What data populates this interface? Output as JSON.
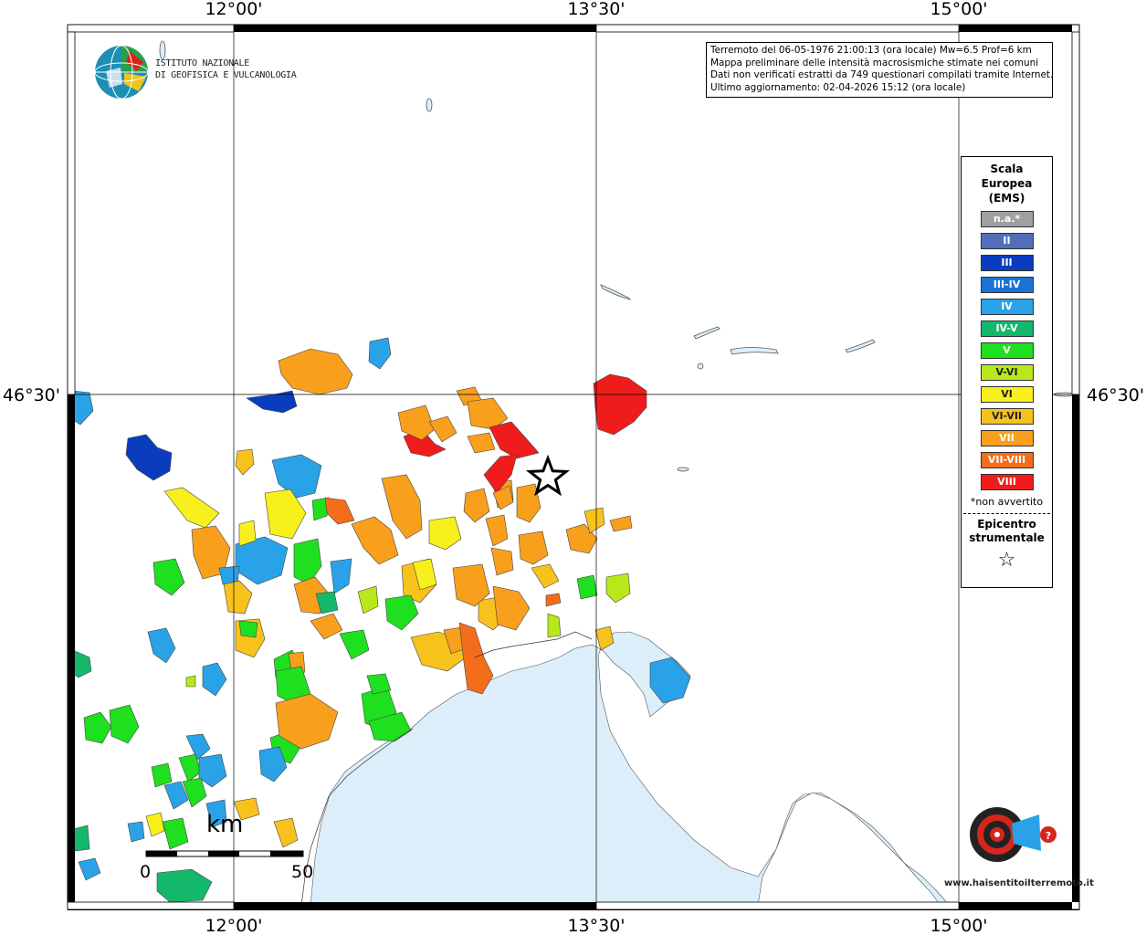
{
  "map": {
    "ticks_top": [
      "12°00'",
      "13°30'",
      "15°00'"
    ],
    "ticks_bottom": [
      "12°00'",
      "13°30'",
      "15°00'"
    ],
    "ticks_left": [
      "46°30'"
    ],
    "ticks_right": [
      "46°30'"
    ]
  },
  "info": {
    "line1": "Terremoto del 06-05-1976 21:00:13 (ora locale) Mw=6.5 Prof=6 km",
    "line2": "Mappa preliminare delle intensità macrosismiche stimate nei comuni",
    "line3": "Dati non verificati estratti da 749 questionari compilati tramite Internet.",
    "line4": "Ultimo aggiornamento: 02-04-2026 15:12 (ora locale)"
  },
  "logo": {
    "line1": "ISTITUTO NAZIONALE",
    "line2": "DI GEOFISICA E VULCANOLOGIA"
  },
  "legend": {
    "title1": "Scala",
    "title2": "Europea",
    "title3": "(EMS)",
    "items": [
      {
        "label": "n.a.*",
        "color": "#a0a0a0"
      },
      {
        "label": "II",
        "color": "#4f6fb8"
      },
      {
        "label": "III",
        "color": "#0a3cbe"
      },
      {
        "label": "III-IV",
        "color": "#1c73d6"
      },
      {
        "label": "IV",
        "color": "#2aa2e8"
      },
      {
        "label": "IV-V",
        "color": "#14b86a"
      },
      {
        "label": "V",
        "color": "#1ee01e"
      },
      {
        "label": "V-VI",
        "color": "#b8e81c"
      },
      {
        "label": "VI",
        "color": "#f8f01c"
      },
      {
        "label": "VI-VII",
        "color": "#f8c21c"
      },
      {
        "label": "VII",
        "color": "#f8a01c"
      },
      {
        "label": "VII-VIII",
        "color": "#f46d1a"
      },
      {
        "label": "VIII",
        "color": "#f01c1c"
      }
    ],
    "note": "*non avvertito",
    "epicenter1": "Epicentro",
    "epicenter2": "strumentale",
    "star": "☆"
  },
  "scale": {
    "unit": "km",
    "min": "0",
    "max": "50"
  },
  "site_logo": {
    "text": "www.haisentitoilterremoto.it"
  },
  "colors": {
    "sea": "#dceefa",
    "frame": "#000000"
  }
}
